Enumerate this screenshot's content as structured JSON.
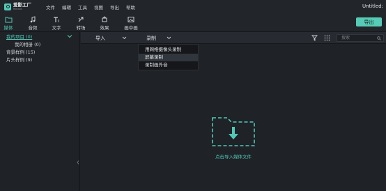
{
  "app": {
    "logo_name": "爱影工厂",
    "logo_sub": "filmora",
    "window_title": "Untitled:"
  },
  "menu": [
    "文件",
    "编辑",
    "工具",
    "视图",
    "导出",
    "帮助"
  ],
  "toolbar": {
    "items": [
      {
        "label": "媒体",
        "icon": "folder-icon",
        "active": true
      },
      {
        "label": "音频",
        "icon": "music-note-icon",
        "active": false
      },
      {
        "label": "文字",
        "icon": "text-icon",
        "active": false
      },
      {
        "label": "转场",
        "icon": "transition-icon",
        "active": false
      },
      {
        "label": "效果",
        "icon": "effects-icon",
        "active": false
      },
      {
        "label": "画中画",
        "icon": "picture-in-picture-icon",
        "active": false
      }
    ],
    "export_label": "导出"
  },
  "library": {
    "items": [
      {
        "label": "我的项目 (0)",
        "selected": true
      },
      {
        "label": "我的相册 (0)",
        "selected": false
      },
      {
        "label": "背景样例 (15)",
        "selected": false
      },
      {
        "label": "片头样例 (9)",
        "selected": false
      }
    ]
  },
  "media_header": {
    "import_label": "导入",
    "record_label": "录制",
    "search_placeholder": "搜索"
  },
  "record_menu": {
    "items": [
      {
        "label": "用网络摄像头录制",
        "hover": false
      },
      {
        "label": "屏幕录制",
        "hover": true
      },
      {
        "label": "录制画外音",
        "hover": false
      }
    ]
  },
  "drop_zone": {
    "label": "点击导入媒体文件"
  },
  "colors": {
    "accent": "#51c9b7",
    "button": "#56ccb6",
    "background": "#1f2227",
    "panel": "#22262b"
  }
}
